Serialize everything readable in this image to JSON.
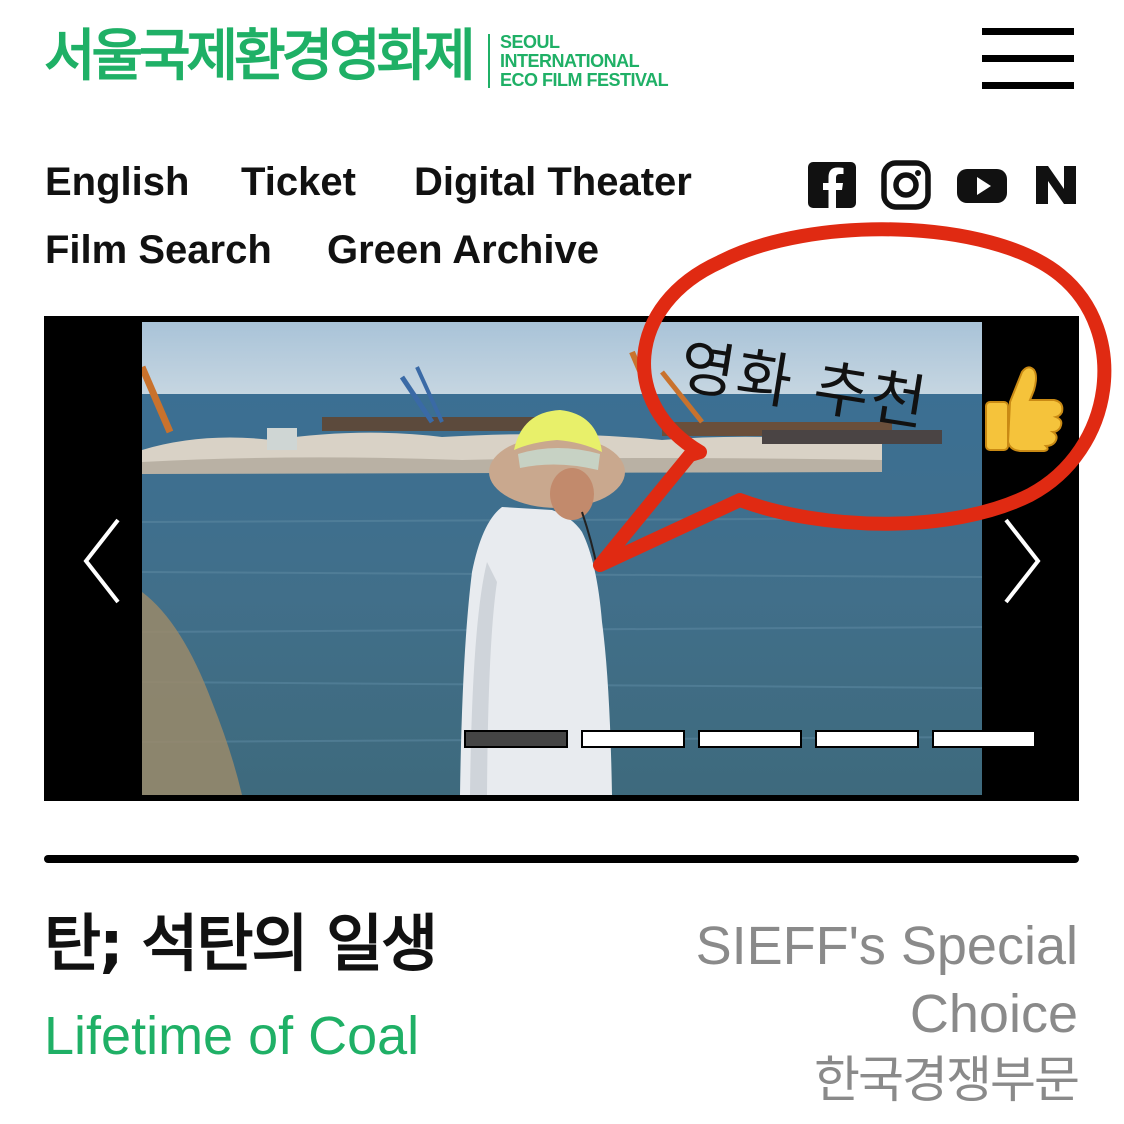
{
  "header": {
    "logo_ko": "서울국제환경영화제",
    "logo_en_line1": "SEOUL",
    "logo_en_line2": "INTERNATIONAL",
    "logo_en_line3": "ECO FILM FESTIVAL",
    "menu_icon": "hamburger-menu-icon"
  },
  "nav": {
    "english": "English",
    "ticket": "Ticket",
    "digital_theater": "Digital Theater",
    "film_search": "Film Search",
    "green_archive": "Green Archive"
  },
  "social": [
    "facebook-icon",
    "instagram-icon",
    "youtube-icon",
    "naver-icon"
  ],
  "slider": {
    "current_slide": 1,
    "total_slides": 5,
    "prev_icon": "chevron-left-icon",
    "next_icon": "chevron-right-icon"
  },
  "annotation": {
    "text": "영화 추천",
    "emoji": "thumbs-up-icon",
    "color": "#e02a12"
  },
  "film": {
    "title_ko": "탄; 석탄의 일생",
    "title_en": "Lifetime of Coal",
    "section_en_line1": "SIEFF's Special",
    "section_en_line2": "Choice",
    "section_ko": "한국경쟁부문"
  },
  "colors": {
    "brand_green": "#1fb066",
    "muted_gray": "#8a8a8a"
  }
}
